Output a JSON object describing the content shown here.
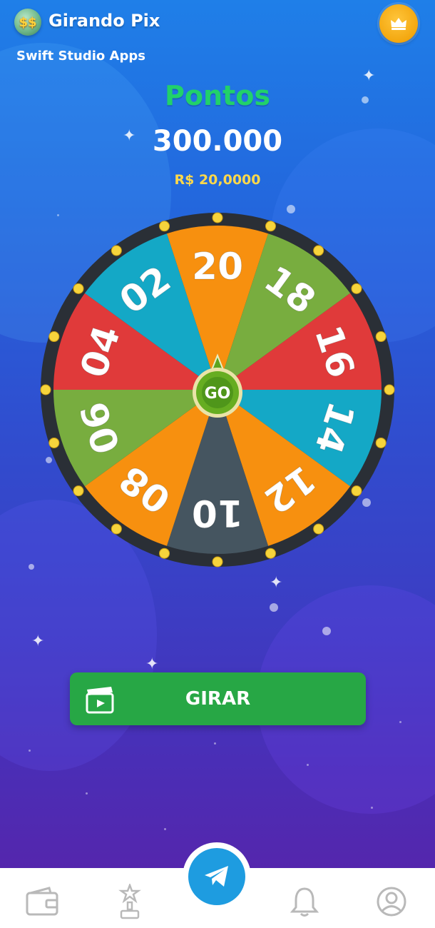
{
  "header": {
    "app_icon_text": "$$",
    "app_title": "Girando Pix",
    "subtitle": "Swift Studio Apps",
    "crown_icon": "crown-icon"
  },
  "score": {
    "label": "Pontos",
    "points": "300.000",
    "money": "R$ 20,0000"
  },
  "wheel": {
    "center_label": "GO",
    "segments": [
      {
        "label": "20",
        "color": "#f7900f"
      },
      {
        "label": "18",
        "color": "#78ad3f"
      },
      {
        "label": "16",
        "color": "#e03a3a"
      },
      {
        "label": "14",
        "color": "#14a8c6"
      },
      {
        "label": "12",
        "color": "#f7900f"
      },
      {
        "label": "10",
        "color": "#455560"
      },
      {
        "label": "08",
        "color": "#f7900f"
      },
      {
        "label": "06",
        "color": "#78ad3f"
      },
      {
        "label": "04",
        "color": "#e03a3a"
      },
      {
        "label": "02",
        "color": "#14a8c6"
      }
    ]
  },
  "action": {
    "girar_label": "GIRAR",
    "icon": "clapperboard-icon"
  },
  "nav": {
    "items": [
      "wallet-icon",
      "trophy-icon",
      "telegram-icon",
      "bell-icon",
      "profile-icon"
    ]
  },
  "colors": {
    "accent_green": "#21d16a",
    "button_green": "#27a745",
    "gold": "#ffd84a",
    "telegram_blue": "#1e9ce0"
  }
}
